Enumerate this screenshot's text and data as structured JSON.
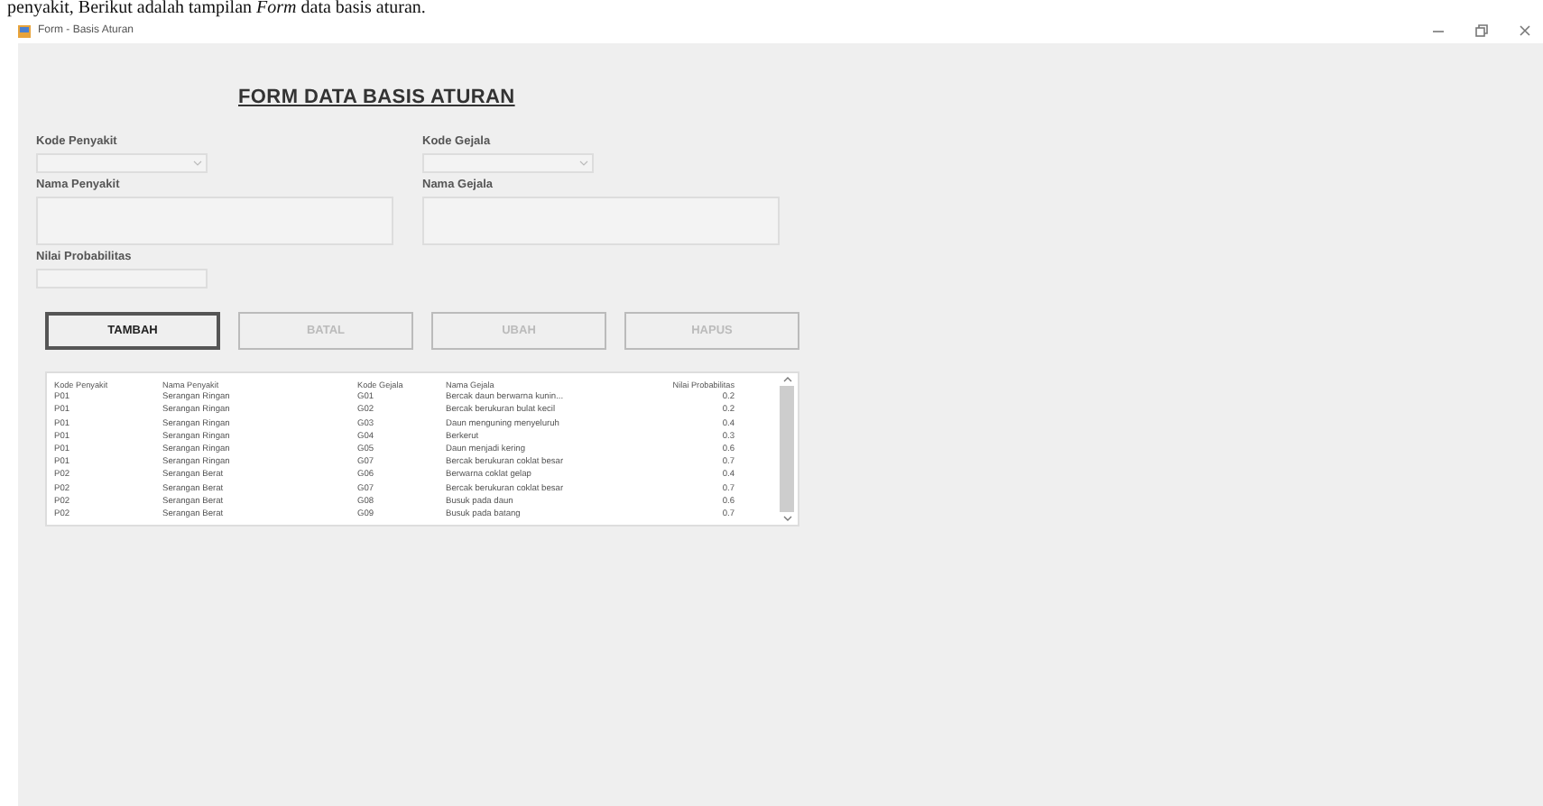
{
  "document_text": "penyakit, Berikut adalah tampilan *Form* data basis aturan.",
  "window": {
    "title": "Form - Basis Aturan"
  },
  "heading": "FORM DATA BASIS ATURAN",
  "left_fields": [
    {
      "label": "Kode Penyakit",
      "kind": "combo"
    },
    {
      "label": "Nama Penyakit",
      "kind": "textarea"
    },
    {
      "label": "Nilai Probabilitas",
      "kind": "text"
    }
  ],
  "right_fields": [
    {
      "label": "Kode Gejala",
      "kind": "combo"
    },
    {
      "label": "Nama Gejala",
      "kind": "textarea"
    }
  ],
  "buttons": [
    {
      "label": "TAMBAH",
      "disabled": false
    },
    {
      "label": "BATAL",
      "disabled": true
    },
    {
      "label": "UBAH",
      "disabled": true
    },
    {
      "label": "HAPUS",
      "disabled": true
    }
  ],
  "table": {
    "columns": [
      "Kode Penyakit",
      "Nama Penyakit",
      "Kode Gejala",
      "Nama Gejala",
      "Nilai Probabilitas"
    ],
    "rows": [
      [
        "P01",
        "Serangan Ringan",
        "G01",
        "Bercak daun berwarna kunin...",
        "0.2"
      ],
      [
        "P01",
        "Serangan Ringan",
        "G02",
        "Bercak berukuran bulat kecil",
        "0.2"
      ],
      [
        "P01",
        "Serangan Ringan",
        "G03",
        "Daun menguning menyeluruh",
        "0.4"
      ],
      [
        "P01",
        "Serangan Ringan",
        "G04",
        "Berkerut",
        "0.3"
      ],
      [
        "P01",
        "Serangan Ringan",
        "G05",
        "Daun menjadi kering",
        "0.6"
      ],
      [
        "P01",
        "Serangan Ringan",
        "G07",
        "Bercak berukuran coklat besar",
        "0.7"
      ],
      [
        "P02",
        "Serangan Berat",
        "G06",
        "Berwarna coklat gelap",
        "0.4"
      ],
      [
        "P02",
        "Serangan Berat",
        "G07",
        "Bercak berukuran coklat besar",
        "0.7"
      ],
      [
        "P02",
        "Serangan Berat",
        "G08",
        "Busuk pada daun",
        "0.6"
      ],
      [
        "P02",
        "Serangan Berat",
        "G09",
        "Busuk pada batang",
        "0.7"
      ]
    ]
  }
}
